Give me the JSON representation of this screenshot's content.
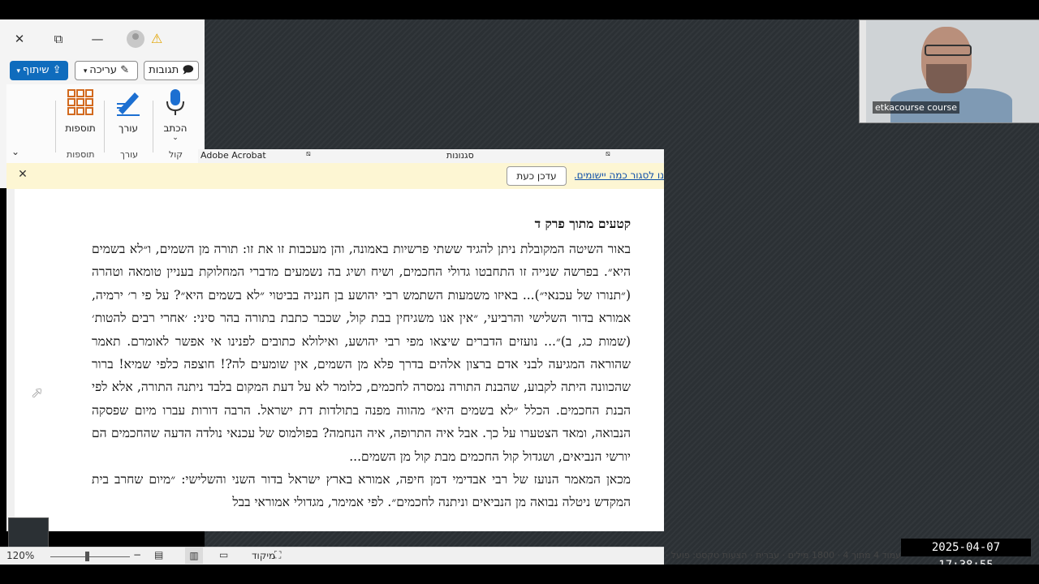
{
  "window": {
    "close_glyph": "✕",
    "restore_glyph": "⧉",
    "minimize_glyph": "—",
    "warning_glyph": "⚠"
  },
  "ribbon": {
    "share_label": "שיתוף",
    "edit_label": "עריכה",
    "comments_label": "תגובות",
    "buttons": [
      {
        "label": "הכתב",
        "icon": "microphone-icon"
      },
      {
        "label": "עורך",
        "icon": "editor-pen-icon"
      },
      {
        "label": "תוספות",
        "icon": "addins-grid-icon"
      }
    ],
    "groups": [
      "קול",
      "עורך",
      "תוספות"
    ],
    "collapse_glyph": "⌄",
    "accent": "#0f6cbd"
  },
  "strip": {
    "acrobat": "Adobe Acrobat",
    "styles": "סגנונות"
  },
  "notification": {
    "text": "נו לסגור כמה יישומים.",
    "update_button": "עדכן כעת",
    "close_glyph": "✕"
  },
  "document": {
    "title": "קטעים מתוך פרק ד",
    "para1": "באור השיטה המקובלת ניתן להגיד ששתי פרשיות באמונה, והן מעכבות זו את זו: תורה מן השמים, ו״לא בשמים היא״. בפרשה שנייה זו התחבטו גדולי החכמים, ושיח ושיג בה נשמעים מדברי המחלוקת בעניין טומאה וטהרה (״תנורו של עכנאי״)... באיזו משמעות השתמש רבי יהושע בן חנניה בביטוי ״לא בשמים היא״? על פי ר׳ ירמיה, אמורא בדור השלישי והרביעי, ״אין אנו משגיחין בבת קול, שכבר כתבת בתורה בהר סיני: ׳אחרי רבים להטות׳ (שמות כג, ב)״... נועזים הדברים שיצאו מפי רבי יהושע, ואילולא כתובים לפנינו אי אפשר לאומרם. תאמר שהוראה המגיעה לבני אדם ברצון אלהים בדרך פלא מן השמים, אין שומעים לה?! חוצפה כלפי שמיא! ברור שהכוונה היתה לקבוע, שהבנת התורה נמסרה לחכמים, כלומר לא על דעת המקום בלבד ניתנה התורה, אלא לפי הבנת החכמים. הכלל ״לא בשמים היא״ מהווה מפנה בתולדות דת ישראל. הרבה דורות עברו מיום שפסקה הנבואה, ומאד הצטערו על כך. אבל איה התרופה, איה הנחמה? בפולמוס של עכנאי נולדה הדעה שהחכמים הם יורשי הנביאים, ושגדול קול החכמים מבת קול מן השמים...",
    "para2": "מכאן המאמר הנועז של רבי אבדימי דמן חיפה, אמורא בארץ ישראל בדור השני והשלישי: ״מיום שחרב בית המקדש ניטלה נבואה מן הנביאים וניתנה לחכמים״. לפי אמימר, מגדולי אמוראי בבל"
  },
  "status": {
    "zoom": "120%",
    "focus_label": "מיקוד",
    "right_text": "עמוד 4 מתוך 4 · 1800 מילים · עברית · הצעות טקסט: פועל · נגישות: הכל בסדר"
  },
  "webcam": {
    "name": "etkacourse course"
  },
  "timestamp": "2025-04-07  17:38:55"
}
